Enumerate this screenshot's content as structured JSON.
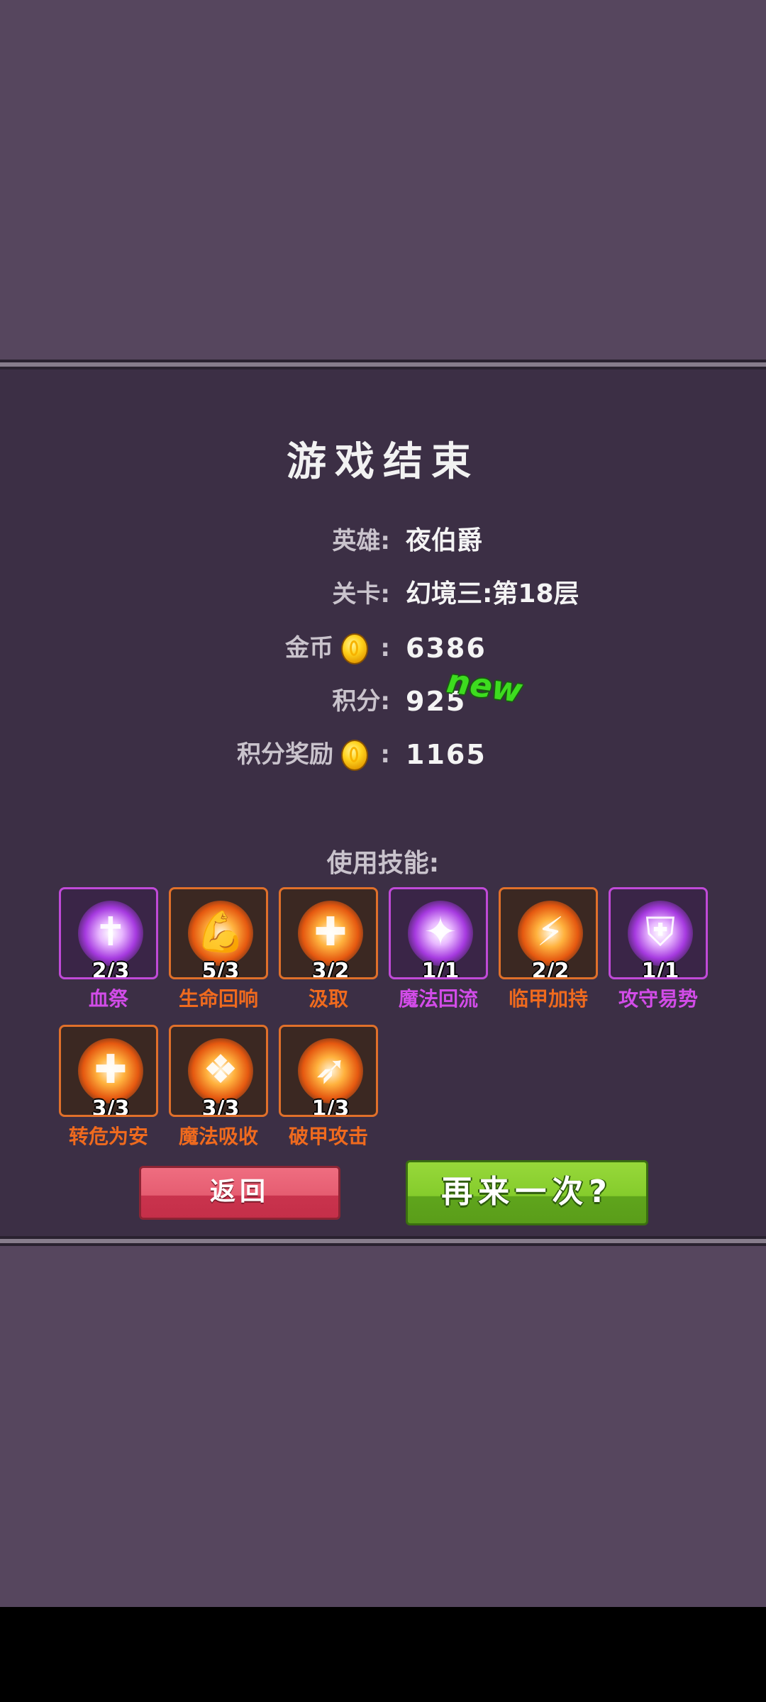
{
  "game_over": {
    "title": "游戏结束",
    "hero_label": "英雄:",
    "hero_value": "夜伯爵",
    "level_label": "关卡:",
    "level_value": "幻境三:第18层",
    "gold_label": "金币",
    "gold_colon": ":",
    "gold_value": "6386",
    "score_label": "积分:",
    "score_value": "925",
    "new_tag": "new",
    "bonus_label": "积分奖励",
    "bonus_colon": ":",
    "bonus_value": "1165",
    "skills_title": "使用技能:",
    "skills": [
      {
        "name": "血祭",
        "count": "2/3",
        "color": "purple",
        "icon": "blood-drop-icon"
      },
      {
        "name": "生命回响",
        "count": "5/3",
        "color": "orange",
        "icon": "muscle-arm-icon"
      },
      {
        "name": "汲取",
        "count": "3/2",
        "color": "orange",
        "icon": "medical-cross-icon"
      },
      {
        "name": "魔法回流",
        "count": "1/1",
        "color": "purple",
        "icon": "magic-runner-icon"
      },
      {
        "name": "临甲加持",
        "count": "2/2",
        "color": "orange",
        "icon": "running-man-icon"
      },
      {
        "name": "攻守易势",
        "count": "1/1",
        "color": "purple",
        "icon": "shield-icon"
      },
      {
        "name": "转危为安",
        "count": "3/3",
        "color": "orange",
        "icon": "healing-runner-icon"
      },
      {
        "name": "魔法吸收",
        "count": "3/3",
        "color": "orange",
        "icon": "winged-emblem-icon"
      },
      {
        "name": "破甲攻击",
        "count": "1/3",
        "color": "orange",
        "icon": "slash-arrow-icon"
      }
    ],
    "back_label": "返回",
    "again_label": "再来一次?"
  }
}
